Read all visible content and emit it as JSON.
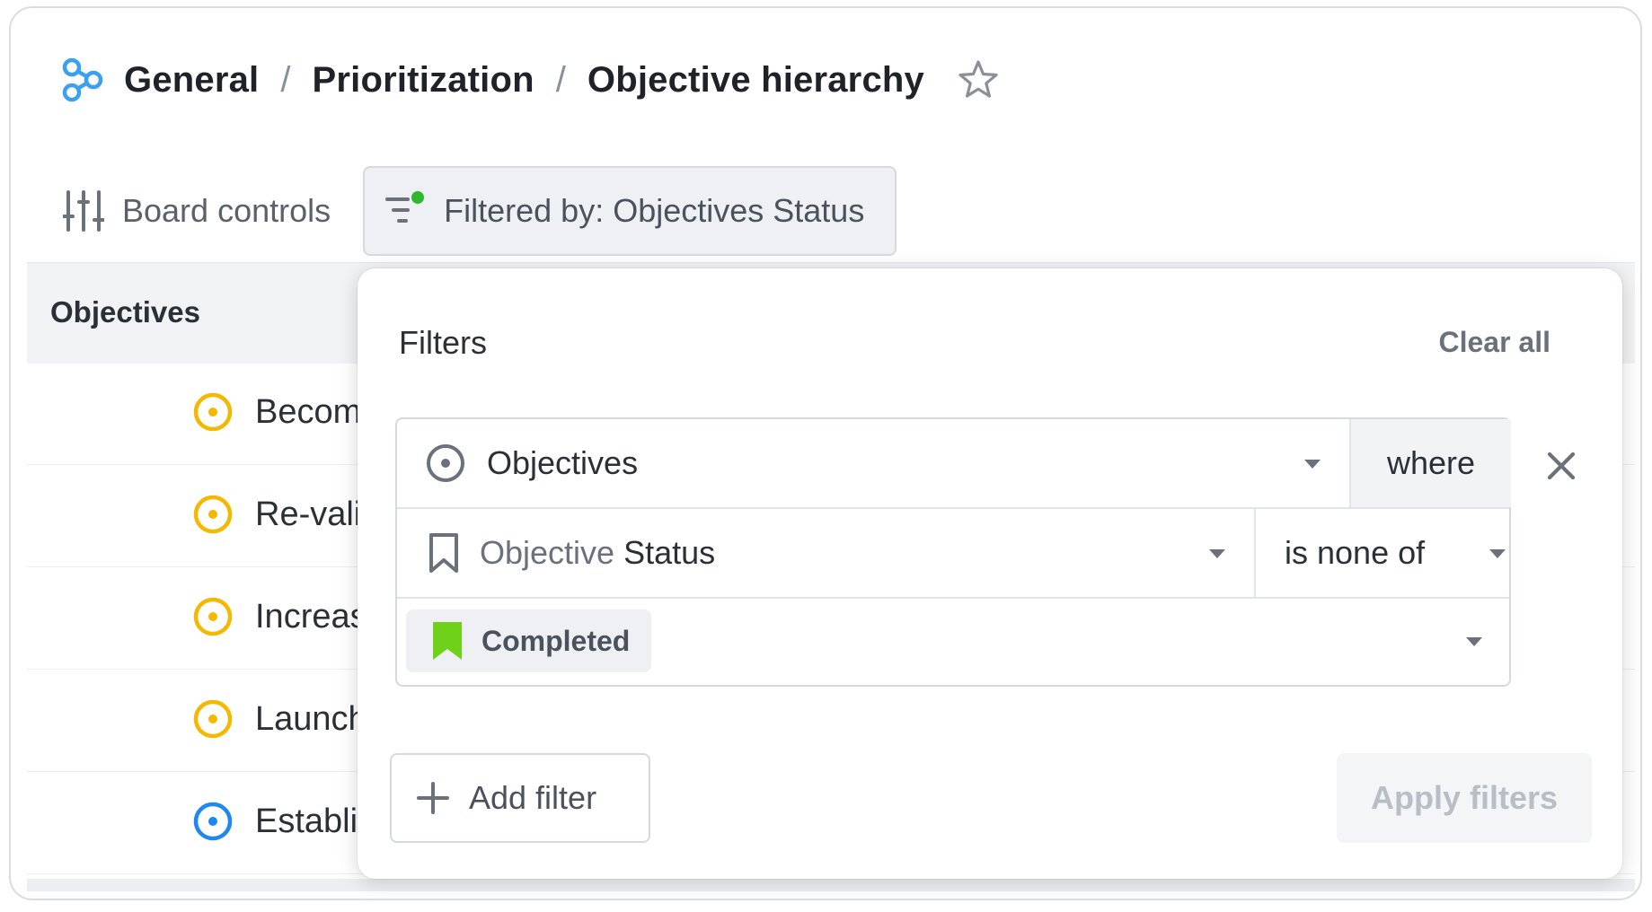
{
  "breadcrumb": {
    "items": [
      "General",
      "Prioritization",
      "Objective hierarchy"
    ],
    "separator": "/"
  },
  "toolbar": {
    "board_controls_label": "Board controls",
    "filtered_label": "Filtered by: Objectives Status"
  },
  "table": {
    "column_title": "Objectives",
    "rows": [
      {
        "text": "Becom",
        "status_color": "#f5b800"
      },
      {
        "text": "Re-vali",
        "status_color": "#f5b800"
      },
      {
        "text": "Increas",
        "status_color": "#f5b800"
      },
      {
        "text": "Launch",
        "status_color": "#f5b800"
      },
      {
        "text": "Establi",
        "status_color": "#1e88f0"
      }
    ]
  },
  "filters": {
    "title": "Filters",
    "clear_all": "Clear all",
    "object_select": "Objectives",
    "where_label": "where",
    "field_prefix": "Objective",
    "field_name": "Status",
    "operator": "is none of",
    "value_chip": "Completed",
    "add_filter": "Add filter",
    "apply": "Apply filters"
  },
  "colors": {
    "brand_logo": "#3aa0f0",
    "filter_active_dot": "#2db82d",
    "completed_chip": "#6fd11a"
  }
}
